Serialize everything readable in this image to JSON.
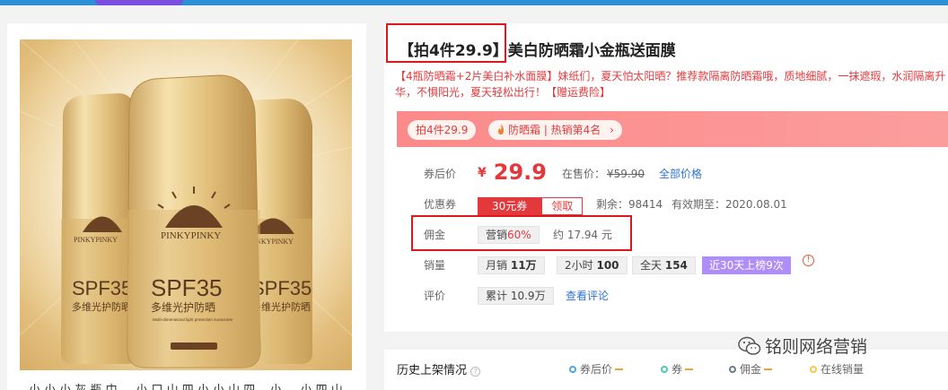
{
  "product": {
    "title_tag": "【拍4件29.9】",
    "title_rest": "美白防晒霜小金瓶送面膜",
    "description": "【4瓶防晒霜+2片美白补水面膜】妹纸们，夏天怕太阳晒？推荐款隔离防晒霜哦，质地细腻，一抹遮瑕，水润隔离升华，不惧阳光，夏天轻松出行！【赠运费险】",
    "bottom_text": "小 小 小 灰 瓶 中 ... 小 口 山 四 小 小 山 四 ...小 ... 小 四 山"
  },
  "image": {
    "bottle_brand": "PINKYPINKY",
    "bottle_spf": "SPF35",
    "bottle_cn": "多维光护防晒",
    "bottle_small": "Multi-dimensional light protection sunscreen"
  },
  "tags": {
    "promo": "拍4件29.9",
    "rank": "防晒霜 | 热销第4名",
    "rank_arrow": "›"
  },
  "price": {
    "label": "券后价",
    "currency": "¥",
    "value": "29.9",
    "onsale_label": "在售价：",
    "onsale_value": "¥59.90",
    "all_prices": "全部价格"
  },
  "coupon": {
    "label": "优惠券",
    "amount": "30元券",
    "claim": "领取",
    "remaining": "剩余：98414",
    "valid_until": "有效期至：2020.08.01"
  },
  "commission": {
    "label": "佣金",
    "type": "营销",
    "rate": "60%",
    "amount": "约 17.94 元"
  },
  "sales": {
    "label": "销量",
    "monthly_label": "月销",
    "monthly_value": "11万",
    "hourly_label": "2小时",
    "hourly_value": "100",
    "daily_label": "全天",
    "daily_value": "154",
    "rank_badge": "近30天上榜9次",
    "info_icon": "!"
  },
  "reviews": {
    "label": "评价",
    "total_label": "累计",
    "total_value": "10.9万",
    "view_link": "查看评论"
  },
  "history": {
    "title": "历史上架情况",
    "help": "?",
    "legend": [
      {
        "label": "券后价",
        "color": "#4aa6e8"
      },
      {
        "label": "券",
        "color": "#4fc9b0"
      },
      {
        "label": "佣金",
        "color": "#6f7a88"
      },
      {
        "label": "在线销量",
        "color": "#f2c94c"
      }
    ]
  },
  "watermark": {
    "text": "铭则网络营销"
  },
  "colors": {
    "accent_red": "#e4393c",
    "link_blue": "#2d73d6",
    "top_bar": "#2d8fd5",
    "purple_badge": "#b08ef7"
  }
}
